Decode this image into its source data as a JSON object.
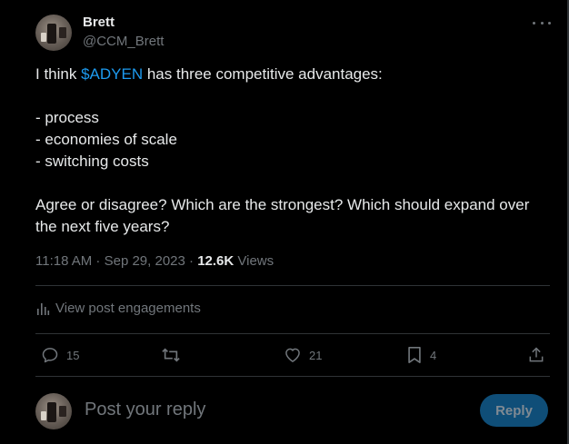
{
  "author": {
    "name": "Brett",
    "handle": "@CCM_Brett"
  },
  "tweet": {
    "text_prefix": "I think ",
    "cashtag": "$ADYEN",
    "text_suffix": " has three competitive advantages:",
    "list": [
      "- process",
      "- economies of scale",
      "- switching costs"
    ],
    "question": "Agree or disagree? Which are the strongest? Which should expand over the next five years?"
  },
  "meta": {
    "time": "11:18 AM",
    "separator": " · ",
    "date": "Sep 29, 2023",
    "views_count": "12.6K",
    "views_label": " Views"
  },
  "engagements_label": "View post engagements",
  "actions": {
    "replies": "15",
    "likes": "21",
    "bookmarks": "4"
  },
  "reply_box": {
    "placeholder": "Post your reply",
    "button_label": "Reply"
  },
  "colors": {
    "background": "#000000",
    "text": "#e7e9ea",
    "muted": "#71767b",
    "link": "#1d9bf0",
    "reply_button": "#0f4e78",
    "divider": "#2f3336"
  }
}
